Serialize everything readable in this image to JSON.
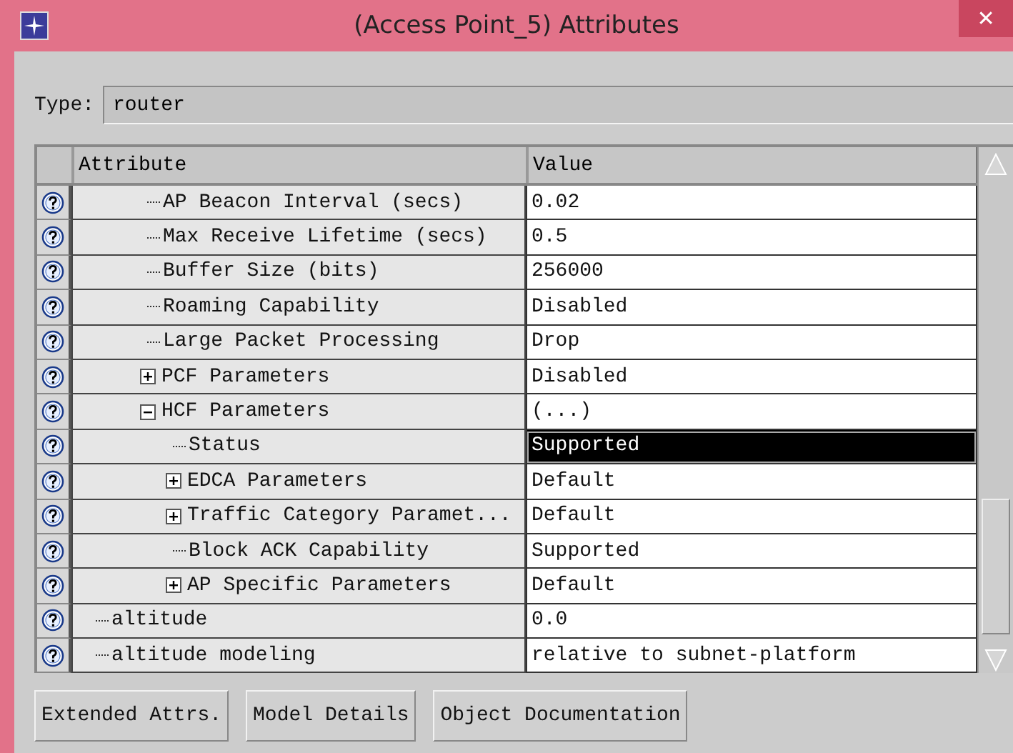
{
  "window": {
    "title": "(Access Point_5) Attributes",
    "close": "✕"
  },
  "type_field": {
    "label": "Type:",
    "value": "router"
  },
  "table": {
    "columns": [
      "Attribute",
      "Value"
    ],
    "rows": [
      {
        "children": [
          {
            "children": [
              {
                "label": "AP Beacon Interval (secs)",
                "value": "0.02",
                "selected": false
              },
              {
                "label": "Max Receive Lifetime (secs)",
                "value": "0.5",
                "selected": false
              },
              {
                "label": "Buffer Size (bits)",
                "value": "256000",
                "selected": false
              },
              {
                "label": "Roaming Capability",
                "value": "Disabled",
                "selected": false
              },
              {
                "label": "Large Packet Processing",
                "value": "Drop",
                "selected": false
              },
              {
                "label": "PCF Parameters",
                "value": "Disabled",
                "selected": false,
                "expanded": false
              },
              {
                "label": "HCF Parameters",
                "value": "(...)",
                "selected": false,
                "expanded": true,
                "children": [
                  {
                    "label": "Status",
                    "value": "Supported",
                    "selected": true
                  },
                  {
                    "label": "EDCA Parameters",
                    "value": "Default",
                    "selected": false,
                    "expanded": false
                  },
                  {
                    "label": "Traffic Category Paramet...",
                    "value": "Default",
                    "selected": false,
                    "expanded": false
                  },
                  {
                    "label": "Block ACK Capability",
                    "value": "Supported",
                    "selected": false
                  },
                  {
                    "label": "AP Specific Parameters",
                    "value": "Default",
                    "selected": false,
                    "expanded": false
                  }
                ]
              }
            ]
          }
        ]
      },
      {
        "label": "altitude",
        "value": "0.0",
        "selected": false
      },
      {
        "label": "altitude modeling",
        "value": "relative to subnet-platform",
        "selected": false
      }
    ]
  },
  "buttons": [
    "Extended Attrs.",
    "Model Details",
    "Object Documentation"
  ]
}
